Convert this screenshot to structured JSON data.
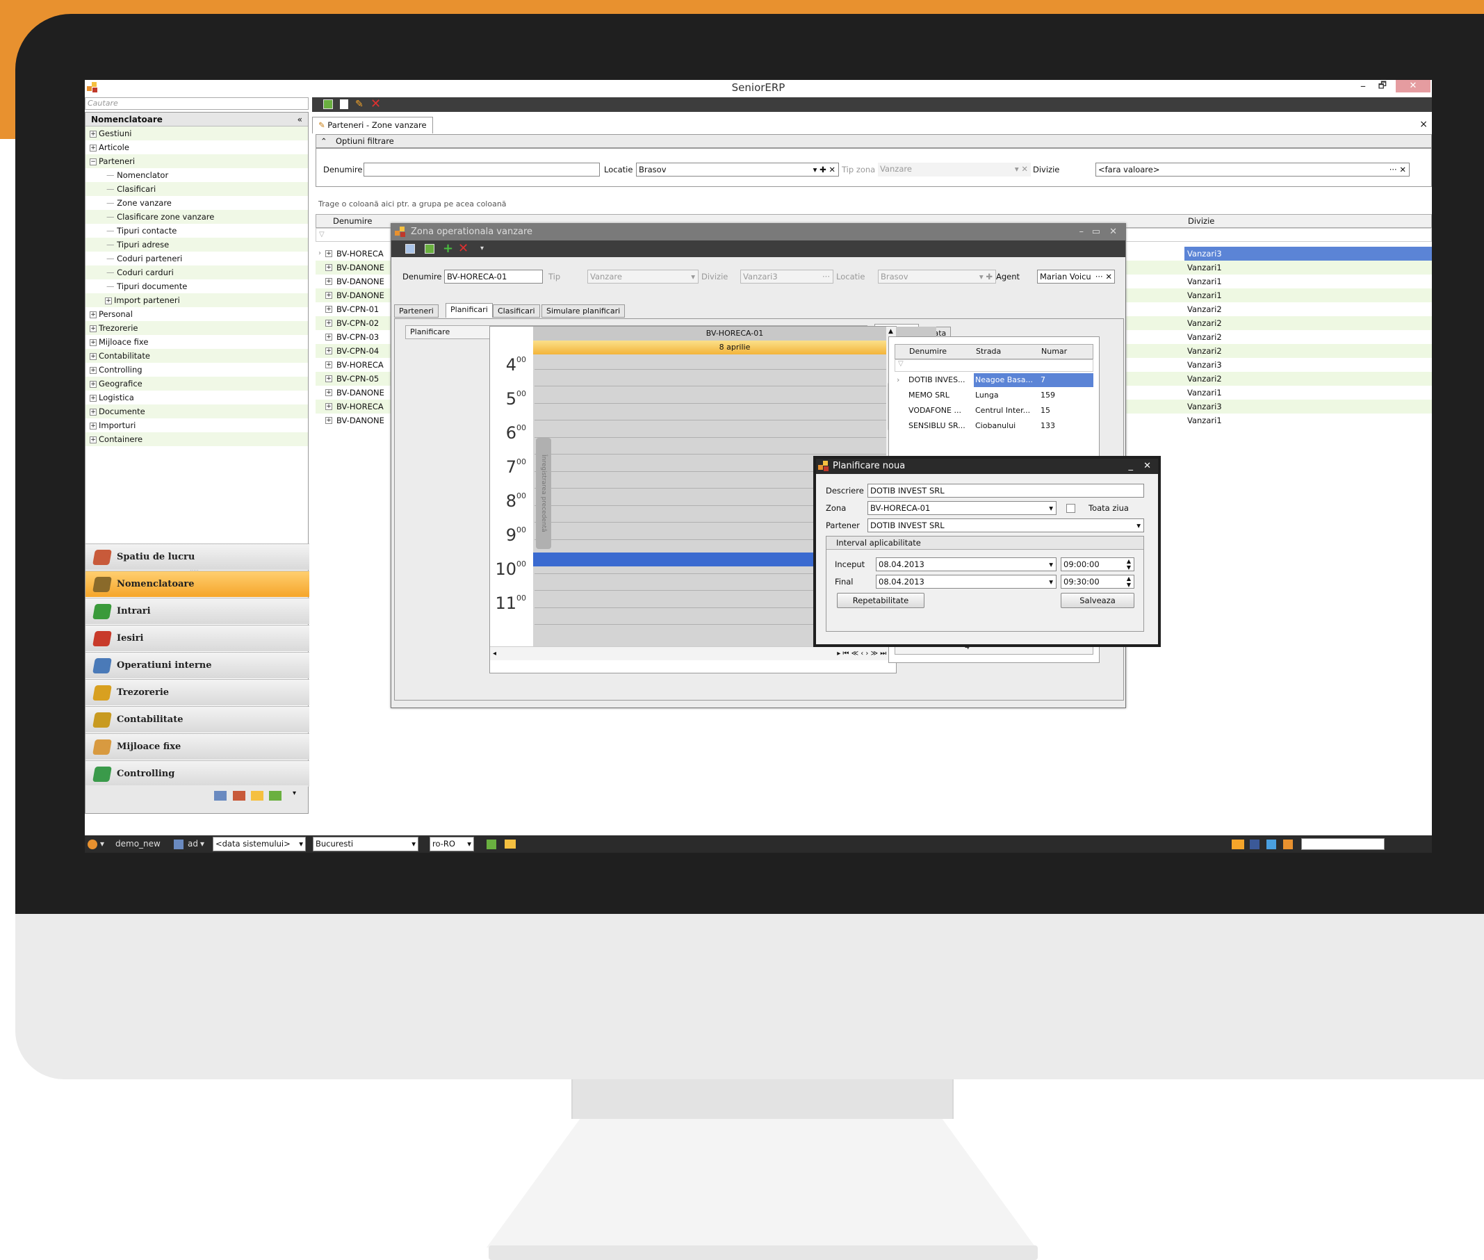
{
  "window": {
    "title": "SeniorERP",
    "min": "–",
    "restore": "🗗",
    "close": "✕"
  },
  "search": {
    "placeholder": "Cautare"
  },
  "left_panel": {
    "title": "Nomenclatoare",
    "collapse": "«",
    "tree": [
      {
        "label": "Gestiuni",
        "lvl": 0,
        "exp": "+"
      },
      {
        "label": "Articole",
        "lvl": 0,
        "exp": "+"
      },
      {
        "label": "Parteneri",
        "lvl": 0,
        "exp": "−"
      },
      {
        "label": "Nomenclator",
        "lvl": 1,
        "exp": ""
      },
      {
        "label": "Clasificari",
        "lvl": 1,
        "exp": ""
      },
      {
        "label": "Zone vanzare",
        "lvl": 1,
        "exp": ""
      },
      {
        "label": "Clasificare zone vanzare",
        "lvl": 1,
        "exp": ""
      },
      {
        "label": "Tipuri contacte",
        "lvl": 1,
        "exp": ""
      },
      {
        "label": "Tipuri adrese",
        "lvl": 1,
        "exp": ""
      },
      {
        "label": "Coduri parteneri",
        "lvl": 1,
        "exp": ""
      },
      {
        "label": "Coduri carduri",
        "lvl": 1,
        "exp": ""
      },
      {
        "label": "Tipuri documente",
        "lvl": 1,
        "exp": ""
      },
      {
        "label": "Import parteneri",
        "lvl": 1,
        "exp": "+"
      },
      {
        "label": "Personal",
        "lvl": 0,
        "exp": "+"
      },
      {
        "label": "Trezorerie",
        "lvl": 0,
        "exp": "+"
      },
      {
        "label": "Mijloace fixe",
        "lvl": 0,
        "exp": "+"
      },
      {
        "label": "Contabilitate",
        "lvl": 0,
        "exp": "+"
      },
      {
        "label": "Controlling",
        "lvl": 0,
        "exp": "+"
      },
      {
        "label": "Geografice",
        "lvl": 0,
        "exp": "+"
      },
      {
        "label": "Logistica",
        "lvl": 0,
        "exp": "+"
      },
      {
        "label": "Documente",
        "lvl": 0,
        "exp": "+"
      },
      {
        "label": "Importuri",
        "lvl": 0,
        "exp": "+"
      },
      {
        "label": "Containere",
        "lvl": 0,
        "exp": "+"
      }
    ]
  },
  "nav": [
    {
      "label": "Spatiu de lucru",
      "color": "#c85a3a"
    },
    {
      "label": "Nomenclatoare",
      "color": "#8a6a2a"
    },
    {
      "label": "Intrari",
      "color": "#3a9a3a"
    },
    {
      "label": "Iesiri",
      "color": "#c83a2a"
    },
    {
      "label": "Operatiuni interne",
      "color": "#4a7ab8"
    },
    {
      "label": "Trezorerie",
      "color": "#d8a020"
    },
    {
      "label": "Contabilitate",
      "color": "#c89a20"
    },
    {
      "label": "Mijloace fixe",
      "color": "#d89a40"
    },
    {
      "label": "Controlling",
      "color": "#3a9a4a"
    }
  ],
  "nav_active": 1,
  "doc_tab": "Parteneri - Zone vanzare",
  "doc_tab_close": "×",
  "filters": {
    "section": "Optiuni filtrare",
    "section_icon": "⌃",
    "denumire_label": "Denumire",
    "denumire_value": "",
    "locatie_label": "Locatie",
    "locatie_value": "Brasov",
    "tipzona_label": "Tip zona",
    "tipzona_value": "Vanzare",
    "divizie_label": "Divizie",
    "divizie_value": "<fara valoare>"
  },
  "group_hint": "Trage o coloană aici ptr. a grupa pe acea coloană",
  "grid": {
    "col_denumire": "Denumire",
    "col_divizie": "Divizie",
    "rows": [
      {
        "name": "BV-HORECA",
        "div": "Vanzari3"
      },
      {
        "name": "BV-DANONE",
        "div": "Vanzari1"
      },
      {
        "name": "BV-DANONE",
        "div": "Vanzari1"
      },
      {
        "name": "BV-DANONE",
        "div": "Vanzari1"
      },
      {
        "name": "BV-CPN-01",
        "div": "Vanzari2"
      },
      {
        "name": "BV-CPN-02",
        "div": "Vanzari2"
      },
      {
        "name": "BV-CPN-03",
        "div": "Vanzari2"
      },
      {
        "name": "BV-CPN-04",
        "div": "Vanzari2"
      },
      {
        "name": "BV-HORECA",
        "div": "Vanzari3"
      },
      {
        "name": "BV-CPN-05",
        "div": "Vanzari2"
      },
      {
        "name": "BV-DANONE",
        "div": "Vanzari1"
      },
      {
        "name": "BV-HORECA",
        "div": "Vanzari3"
      },
      {
        "name": "BV-DANONE",
        "div": "Vanzari1"
      }
    ]
  },
  "zona_dialog": {
    "title": "Zona operationala vanzare",
    "denumire_label": "Denumire",
    "denumire_value": "BV-HORECA-01",
    "tip_label": "Tip",
    "tip_value": "Vanzare",
    "divizie_label": "Divizie",
    "divizie_value": "Vanzari3",
    "locatie_label": "Locatie",
    "locatie_value": "Brasov",
    "agent_label": "Agent",
    "agent_value": "Marian Voicu",
    "tabs": [
      "Parteneri",
      "Planificari",
      "Clasificari",
      "Simulare planificari"
    ],
    "plan_label": "Planificare",
    "resource": "BV-HORECA-01",
    "date": "8 aprilie",
    "side_tab": "Înregistrarea precedentă",
    "hours": [
      "4",
      "5",
      "6",
      "7",
      "8",
      "9",
      "10",
      "11"
    ],
    "hour_min": "00",
    "right_tabs": [
      "Parteneri",
      "Data"
    ],
    "partners_cols": [
      "Denumire",
      "Strada",
      "Numar"
    ],
    "partners": [
      {
        "d": "DOTIB INVES...",
        "s": "Neagoe Basa...",
        "n": "7"
      },
      {
        "d": "MEMO SRL",
        "s": "Lunga",
        "n": "159"
      },
      {
        "d": "VODAFONE ...",
        "s": "Centrul Inter...",
        "n": "15"
      },
      {
        "d": "SENSIBLU SR...",
        "s": "Ciobanului",
        "n": "133"
      }
    ],
    "partners_count": "4"
  },
  "plan_dialog": {
    "title": "Planificare noua",
    "descriere_label": "Descriere",
    "descriere_value": "DOTIB INVEST SRL",
    "zona_label": "Zona",
    "zona_value": "BV-HORECA-01",
    "toata_label": "Toata ziua",
    "partener_label": "Partener",
    "partener_value": "DOTIB INVEST SRL",
    "interval_label": "Interval aplicabilitate",
    "inceput_label": "Inceput",
    "inceput_date": "08.04.2013",
    "inceput_time": "09:00:00",
    "final_label": "Final",
    "final_date": "08.04.2013",
    "final_time": "09:30:00",
    "repet_btn": "Repetabilitate",
    "save_btn": "Salveaza"
  },
  "status": {
    "db": "demo_new",
    "user": "ad",
    "date": "<data sistemului>",
    "city": "Bucuresti",
    "lang": "ro-RO"
  }
}
